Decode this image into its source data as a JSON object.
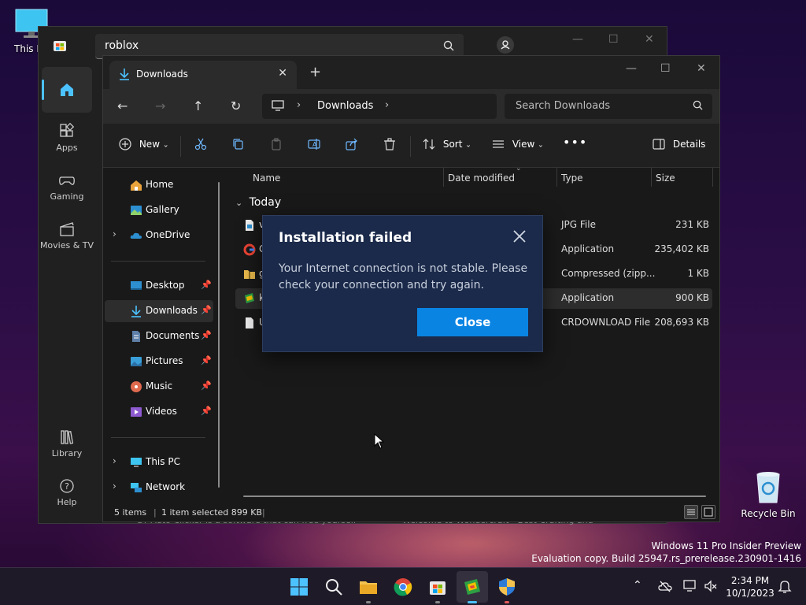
{
  "desktop": {
    "this_pc_label": "This PC",
    "recycle_bin_label": "Recycle Bin",
    "watermark_line1": "Windows 11 Pro Insider Preview",
    "watermark_line2": "Evaluation copy. Build 25947.rs_prerelease.230901-1416"
  },
  "store": {
    "search_value": "roblox",
    "nav": [
      {
        "label": "",
        "icon": "home-icon"
      },
      {
        "label": "Apps",
        "icon": "apps-icon"
      },
      {
        "label": "Gaming",
        "icon": "gamepad-icon"
      },
      {
        "label": "Movies & TV",
        "icon": "film-icon"
      },
      {
        "label": "Library",
        "icon": "library-icon"
      },
      {
        "label": "Help",
        "icon": "help-icon"
      }
    ],
    "ghost_text_1": "GT Auto Clicker is a software that can free yourself",
    "ghost_text_2": "Welcome to Wondercraft - Best Crafting and"
  },
  "explorer": {
    "tab_label": "Downloads",
    "address_crumb": "Downloads",
    "search_placeholder": "Search Downloads",
    "commands": {
      "new": "New",
      "sort": "Sort",
      "view": "View",
      "details": "Details"
    },
    "nav": {
      "home": "Home",
      "gallery": "Gallery",
      "onedrive": "OneDrive",
      "desktop": "Desktop",
      "downloads": "Downloads",
      "documents": "Documents",
      "pictures": "Pictures",
      "music": "Music",
      "videos": "Videos",
      "thispc": "This PC",
      "network": "Network"
    },
    "columns": {
      "name": "Name",
      "date": "Date modified",
      "type": "Type",
      "size": "Size"
    },
    "group_label": "Today",
    "files": [
      {
        "name": "v",
        "type": "JPG File",
        "size": "231 KB"
      },
      {
        "name": "G",
        "type": "Application",
        "size": "235,402 KB"
      },
      {
        "name": "g",
        "type": "Compressed (zipp...",
        "size": "1 KB"
      },
      {
        "name": "k",
        "type": "Application",
        "size": "900 KB"
      },
      {
        "name": "U",
        "type": "CRDOWNLOAD File",
        "size": "208,693 KB"
      }
    ],
    "status": {
      "items": "5 items",
      "selected": "1 item selected  899 KB"
    }
  },
  "dialog": {
    "title": "Installation failed",
    "message": "Your Internet connection is not stable. Please check your connection and try again.",
    "close_label": "Close"
  },
  "taskbar": {
    "time": "2:34 PM",
    "date": "10/1/2023"
  },
  "colors": {
    "accent": "#0a84e3",
    "dialog_bg": "#1b2a4a",
    "explorer_bg": "#191919"
  }
}
